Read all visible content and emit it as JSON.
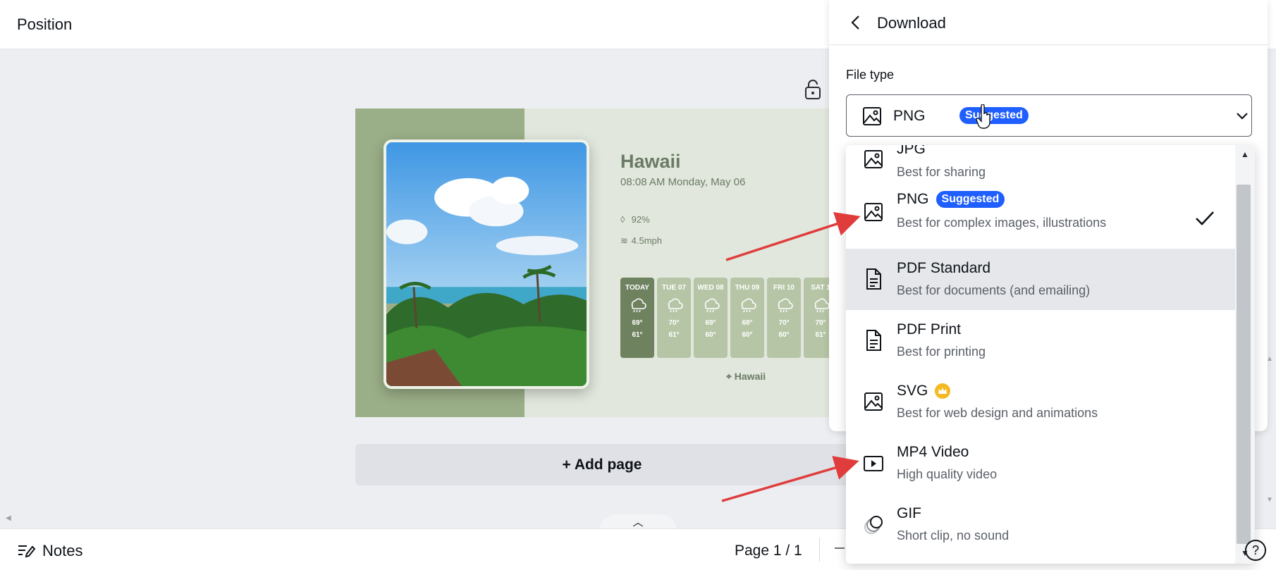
{
  "topbar": {
    "title": "Position"
  },
  "design": {
    "city": "Hawaii",
    "datetime": "08:08 AM  Monday, May 06",
    "humidity": "92%",
    "wind": "4.5mph",
    "location": "Hawaii",
    "days": [
      {
        "label": "TODAY",
        "high": "69°",
        "low": "61°"
      },
      {
        "label": "TUE 07",
        "high": "70°",
        "low": "61°"
      },
      {
        "label": "WED 08",
        "high": "69°",
        "low": "60°"
      },
      {
        "label": "THU 09",
        "high": "68°",
        "low": "60°"
      },
      {
        "label": "FRI 10",
        "high": "70°",
        "low": "60°"
      },
      {
        "label": "SAT 1",
        "high": "70°",
        "low": "61°"
      }
    ]
  },
  "add_page": "+ Add page",
  "bottombar": {
    "notes": "Notes",
    "page_info": "Page 1 / 1"
  },
  "panel": {
    "title": "Download",
    "file_type_label": "File type",
    "selected": {
      "name": "PNG",
      "badge": "Suggested"
    }
  },
  "dropdown": {
    "options": [
      {
        "name": "JPG",
        "desc": "Best for sharing",
        "icon": "image-icon"
      },
      {
        "name": "PNG",
        "badge": "Suggested",
        "desc": "Best for complex images, illustrations",
        "icon": "image-icon",
        "selected": true
      },
      {
        "name": "PDF Standard",
        "desc": "Best for documents (and emailing)",
        "icon": "document-icon",
        "hovered": true
      },
      {
        "name": "PDF Print",
        "desc": "Best for printing",
        "icon": "document-icon"
      },
      {
        "name": "SVG",
        "desc": "Best for web design and animations",
        "icon": "image-icon",
        "premium": true
      },
      {
        "name": "MP4 Video",
        "desc": "High quality video",
        "icon": "video-icon"
      },
      {
        "name": "GIF",
        "desc": "Short clip, no sound",
        "icon": "gif-icon"
      }
    ]
  },
  "colors": {
    "accent": "#1f5eff",
    "annotation": "#e03c3c",
    "premium": "#f5b922",
    "sage": "#9aae87"
  }
}
